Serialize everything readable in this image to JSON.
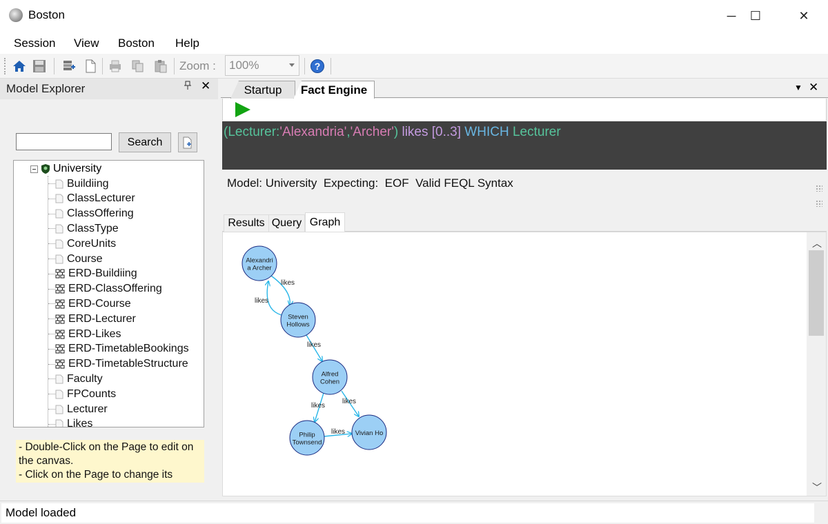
{
  "window": {
    "title": "Boston",
    "minimize": "─",
    "maximize": "☐",
    "close": "✕"
  },
  "menu": {
    "items": [
      {
        "label": "Session"
      },
      {
        "label": "View"
      },
      {
        "label": "Boston"
      },
      {
        "label": "Help"
      }
    ]
  },
  "toolbar": {
    "icons": [
      "home-icon",
      "save-icon",
      "new-model-icon",
      "new-page-icon",
      "print-icon",
      "copy-icon",
      "paste-icon",
      "help-icon"
    ],
    "zoom_label": "Zoom :",
    "zoom_value": "100%"
  },
  "model_explorer": {
    "title": "Model Explorer",
    "pin": "📌",
    "close": "✕",
    "search_button": "Search",
    "search_value": "",
    "tree_root": "University",
    "tree_items": [
      {
        "label": "Buildiing",
        "icon": "page-icon"
      },
      {
        "label": "ClassLecturer",
        "icon": "page-icon"
      },
      {
        "label": "ClassOffering",
        "icon": "page-icon"
      },
      {
        "label": "ClassType",
        "icon": "page-icon"
      },
      {
        "label": "CoreUnits",
        "icon": "page-icon"
      },
      {
        "label": "Course",
        "icon": "page-icon"
      },
      {
        "label": "ERD-Buildiing",
        "icon": "erd-icon"
      },
      {
        "label": "ERD-ClassOffering",
        "icon": "erd-icon"
      },
      {
        "label": "ERD-Course",
        "icon": "erd-icon"
      },
      {
        "label": "ERD-Lecturer",
        "icon": "erd-icon"
      },
      {
        "label": "ERD-Likes",
        "icon": "erd-icon"
      },
      {
        "label": "ERD-TimetableBookings",
        "icon": "erd-icon"
      },
      {
        "label": "ERD-TimetableStructure",
        "icon": "erd-icon"
      },
      {
        "label": "Faculty",
        "icon": "page-icon"
      },
      {
        "label": "FPCounts",
        "icon": "page-icon"
      },
      {
        "label": "Lecturer",
        "icon": "page-icon"
      },
      {
        "label": "Likes",
        "icon": "page-icon"
      }
    ],
    "hint_lines": [
      "- Double-Click on the Page to edit on the canvas.",
      "- Click on the Page to change its"
    ]
  },
  "document": {
    "tabs": [
      {
        "label": "Startup",
        "active": false
      },
      {
        "label": "Fact Engine",
        "active": true
      }
    ],
    "menu_glyph": "▼",
    "close_glyph": "✕",
    "query_tokens": [
      {
        "text": "(Lecturer:",
        "color": "green"
      },
      {
        "text": "'Alexandria'",
        "color": "pink"
      },
      {
        "text": ",",
        "color": "green"
      },
      {
        "text": "'Archer'",
        "color": "pink"
      },
      {
        "text": ")",
        "color": "green"
      },
      {
        "text": " ",
        "color": "white"
      },
      {
        "text": "likes",
        "color": "violet"
      },
      {
        "text": " [0..3] ",
        "color": "violet"
      },
      {
        "text": "WHICH",
        "color": "blue"
      },
      {
        "text": " Lecturer",
        "color": "green"
      }
    ],
    "status": {
      "model_label": "Model: University",
      "expecting_label": "Expecting:",
      "expecting_value": "EOF",
      "syntax": "Valid FEQL Syntax"
    },
    "result_tabs": [
      {
        "label": "Results",
        "active": false
      },
      {
        "label": "Query",
        "active": false
      },
      {
        "label": "Graph",
        "active": true
      }
    ],
    "graph": {
      "nodes": [
        {
          "id": "alexandria",
          "lines": [
            "Alexandri",
            "a Archer"
          ]
        },
        {
          "id": "steven",
          "lines": [
            "Steven",
            "Hollows"
          ]
        },
        {
          "id": "alfred",
          "lines": [
            "Alfred",
            "Cohen"
          ]
        },
        {
          "id": "philip",
          "lines": [
            "Philip",
            "Townsend"
          ]
        },
        {
          "id": "vivian",
          "lines": [
            "Vivian Ho"
          ]
        }
      ],
      "edges": [
        {
          "from": "alexandria",
          "to": "steven",
          "label": "likes"
        },
        {
          "from": "steven",
          "to": "alexandria",
          "label": "likes"
        },
        {
          "from": "steven",
          "to": "alfred",
          "label": "likes"
        },
        {
          "from": "alfred",
          "to": "philip",
          "label": "likes"
        },
        {
          "from": "alfred",
          "to": "vivian",
          "label": "likes"
        },
        {
          "from": "philip",
          "to": "vivian",
          "label": "likes"
        }
      ],
      "node_fill": "#9ccff5",
      "node_stroke": "#1a2a80",
      "edge_color": "#29b6e8"
    }
  },
  "statusbar": {
    "text": "Model loaded"
  }
}
